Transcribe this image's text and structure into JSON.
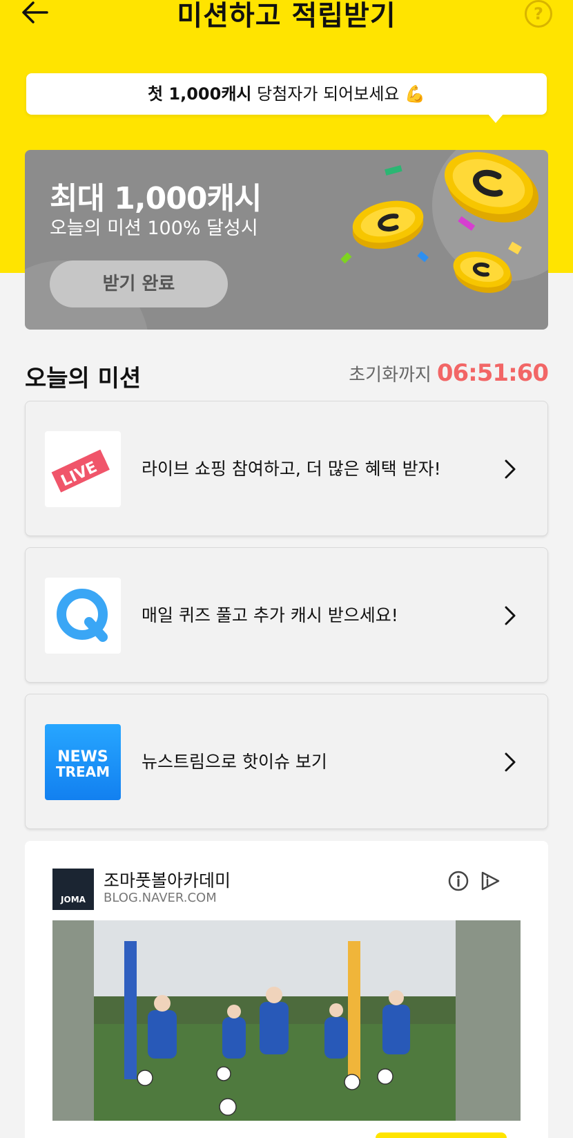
{
  "header": {
    "title": "미션하고 적립받기",
    "help_glyph": "?"
  },
  "bubble": {
    "highlight": "첫 1,000캐시",
    "text": " 당첨자가 되어보세요 💪"
  },
  "hero": {
    "title": "최대 1,000캐시",
    "subtitle": "오늘의 미션 100% 달성시",
    "button_label": "받기 완료"
  },
  "missions_section": {
    "title": "오늘의 미션",
    "reset_label": "초기화까지",
    "reset_timer": "06:51:60"
  },
  "missions": [
    {
      "label": "라이브 쇼핑 참여하고, 더 많은 혜택 받자!",
      "icon": "live-ticket-icon",
      "thumb_text": "LIVE"
    },
    {
      "label": "매일 퀴즈 풀고 추가 캐시 받으세요!",
      "icon": "quiz-q-icon",
      "thumb_text": "Q"
    },
    {
      "label": "뉴스트림으로 핫이슈 보기",
      "icon": "newstream-icon",
      "thumb_text_1": "NEWS",
      "thumb_text_2": "TREAM"
    }
  ],
  "ad": {
    "name": "조마풋볼아카데미",
    "url": "BLOG.NAVER.COM",
    "logo_text": "JOMA"
  },
  "colors": {
    "header_bg": "#ffe400",
    "hero_bg": "#8c8c8c",
    "timer": "#f26666",
    "coin": "#f7c600"
  }
}
